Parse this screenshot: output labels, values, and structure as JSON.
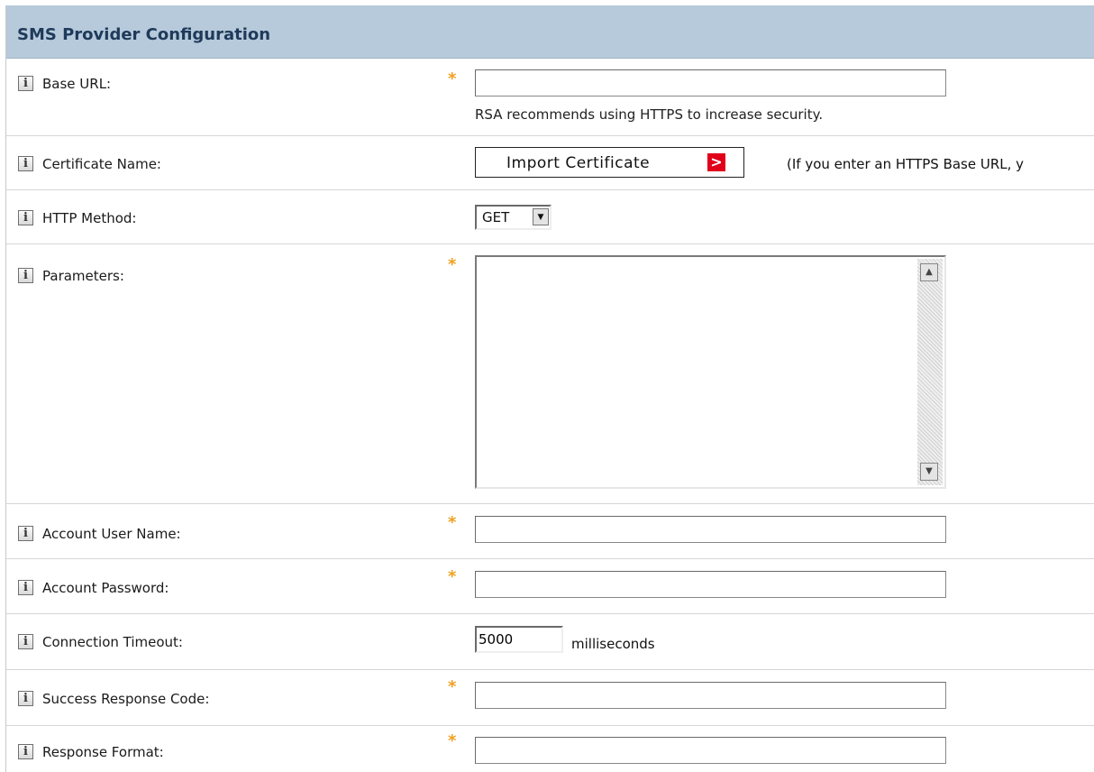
{
  "panel": {
    "title": "SMS Provider Configuration"
  },
  "info_icon_glyph": "i",
  "required_marker": "*",
  "base_url": {
    "label": "Base URL:",
    "value": "",
    "hint": "RSA recommends using HTTPS to increase security."
  },
  "certificate": {
    "label": "Certificate Name:",
    "button_label": "Import Certificate",
    "button_icon": ">",
    "note": "(If you enter an HTTPS Base URL, y"
  },
  "http_method": {
    "label": "HTTP Method:",
    "selected": "GET",
    "dropdown_icon": "▼"
  },
  "parameters": {
    "label": "Parameters:",
    "value": "",
    "scroll_up_icon": "▲",
    "scroll_down_icon": "▼"
  },
  "account_user_name": {
    "label": "Account User Name:",
    "value": ""
  },
  "account_password": {
    "label": "Account Password:",
    "value": ""
  },
  "connection_timeout": {
    "label": "Connection Timeout:",
    "value": "5000",
    "unit": "milliseconds"
  },
  "success_response_code": {
    "label": "Success Response Code:",
    "value": ""
  },
  "response_format": {
    "label": "Response Format:",
    "value": ""
  },
  "colors": {
    "header_bg": "#b7cadb",
    "header_text": "#1f3a5a",
    "required": "#f0a020",
    "button_arrow": "#e0001a"
  }
}
